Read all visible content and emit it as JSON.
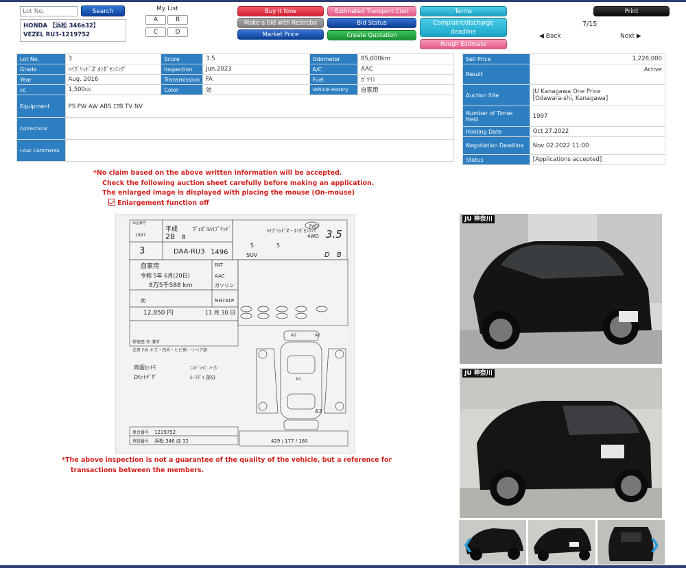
{
  "search": {
    "placeholder": "Lot No.",
    "button": "Search"
  },
  "vehicle": {
    "line1": "HONDA 【浜松 346ã32】",
    "line2": "VEZEL RU3-1219752"
  },
  "mylist": {
    "title": "My List",
    "buttons": [
      "A",
      "B",
      "C",
      "D"
    ]
  },
  "actions": {
    "buy_it_now": "Buy It Now",
    "estimated_transport_cost": "Estimated Transport Cost",
    "terms": "Terms",
    "bid_resirobo": "Make a bid with Resirobo",
    "bid_status": "Bid Status",
    "complaint": "Complaint/discharge deadline",
    "market_price": "Market Price",
    "create_quotation": "Create Quotation",
    "rough_estimate": "Rough Estimate",
    "print": "Print"
  },
  "pager": {
    "position": "7/15",
    "back": "Back",
    "next": "Next"
  },
  "details": {
    "lot_no_label": "Lot No.",
    "lot_no": "3",
    "score_label": "Score",
    "score": "3.5",
    "odometer_label": "Odometer",
    "odometer": "85,000km",
    "grade_label": "Grade",
    "grade": "ﾊｲﾌﾞﾘｯﾄﾞZ ﾎﾝﾀﾞｾﾝｼﾝｸﾞ",
    "inspection_label": "Inspection",
    "inspection": "Jun.2023",
    "ac_label": "A/C",
    "ac": "AAC",
    "year_label": "Year",
    "year": "Aug. 2016",
    "transmission_label": "Transmission",
    "transmission": "FA",
    "fuel_label": "Fuel",
    "fuel": "ｶﾞｿﾘﾝ",
    "cc_label": "cc",
    "cc": "1,500cc",
    "color_label": "Color",
    "color": "効",
    "history_label": "Vehicle History",
    "history": "自家用",
    "equipment_label": "Equipment",
    "equipment": "PS PW AW ABS ｴｱB TV NV",
    "corrections_label": "Corrections",
    "corrections": "",
    "comments_label": "i-Auc Comments",
    "comments": ""
  },
  "sale": {
    "sell_price_label": "Sell Price",
    "sell_price": "1,228,000",
    "result_label": "Result",
    "result": "Active",
    "auction_site_label": "Auction Site",
    "auction_site_1": "JU Kanagawa One Price",
    "auction_site_2": "[Odawara-shi, Kanagawa]",
    "times_held_label": "Number of Times Held",
    "times_held": "1997",
    "holding_date_label": "Holding Date",
    "holding_date": "Oct 27.2022",
    "negotiation_label": "Negotiation Deadline",
    "negotiation": "Nov 02.2022 11:00",
    "status_label": "Status",
    "status": "[Applications accepted]"
  },
  "notices": {
    "line1": "*No claim based on the above written information will be accepted.",
    "line2": "Check the following auction sheet carefully before making an application.",
    "line3": "The enlarged image is displayed with placing the mouse (On-mouse)",
    "enlarge": "Enlargement function off",
    "bottom1": "*The above inspection is not a guarantee of the quality of the vehicle, but a reference for",
    "bottom2": "transactions between the members."
  },
  "sheet": {
    "auction_no": "1997",
    "lot": "3",
    "model": "DAA-RU3",
    "era_year": "28",
    "month": "8",
    "name": "ｳﾞｪｾﾞﾙﾊｲﾌﾞﾘｯﾄﾞ",
    "grade": "ﾊｲﾌﾞﾘｯﾄﾞZ・ﾎﾝﾀﾞｾﾝｼﾝｸﾞ",
    "drive": "4WD",
    "score": "3.5",
    "cc": "1496",
    "doors": "5",
    "seats": "5",
    "body": "SUV",
    "interior": "D",
    "exterior": "B",
    "usage": "自家用",
    "inspection": "令和 5年 6月(20日)",
    "mileage": "8万5千588 km",
    "shift": "FAT",
    "aircon": "AAC",
    "fuel": "ガソリン",
    "color_code": "NH731P",
    "recycle": "12,850 円",
    "date": "11 月 30 日",
    "chassis": "1219752",
    "plate": "浜松 346 ほ 32",
    "dims": "429 / 177 / 160"
  },
  "photos": {
    "brand": "JU 神奈川"
  },
  "colors": {
    "label_blue": "#2d7fc1",
    "notice_red": "#d2201d",
    "link_blue": "#3a68c2"
  }
}
